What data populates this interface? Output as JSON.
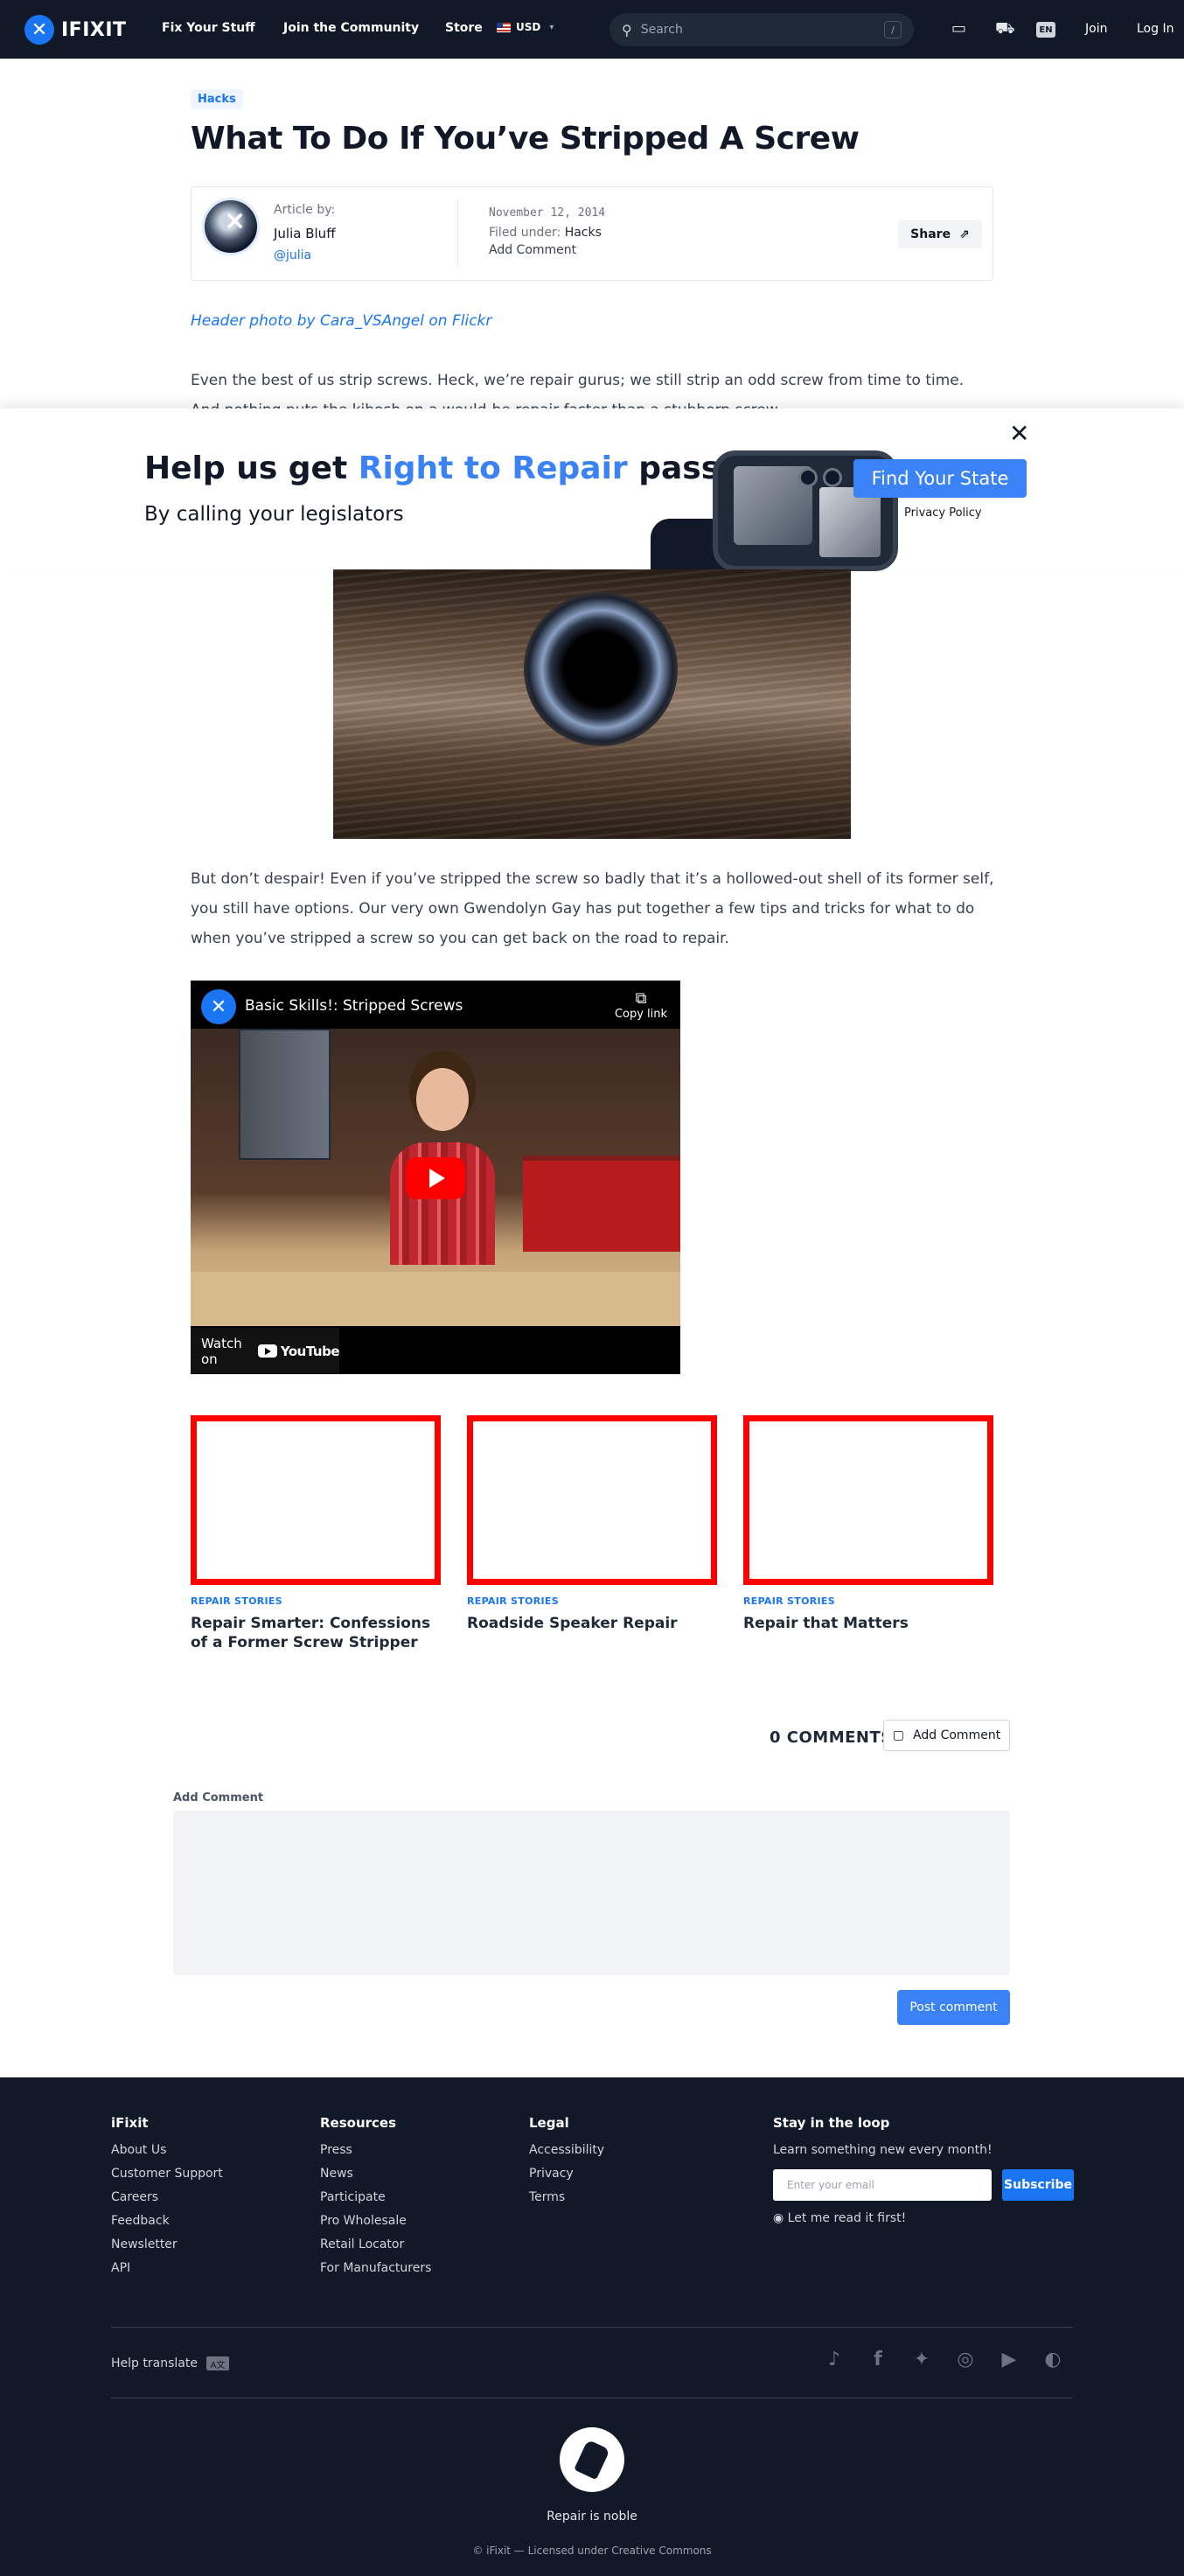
{
  "nav": {
    "brand": "IFIXIT",
    "links": [
      "Fix Your Stuff",
      "Join the Community",
      "Store"
    ],
    "currency": "USD",
    "search_placeholder": "Search",
    "search_shortcut": "/",
    "language": "EN",
    "join": "Join",
    "login": "Log In"
  },
  "article": {
    "tag": "Hacks",
    "title": "What To Do If You’ve Stripped A Screw",
    "byline_label": "Article by:",
    "author": "Julia Bluff",
    "handle": "@julia",
    "date": "November 12, 2014",
    "filed_label": "Filed under:",
    "filed_value": "Hacks",
    "add_comment": "Add Comment",
    "share": "Share",
    "photo_credit": "Header photo by Cara_VSAngel on Flickr",
    "para1": "Even the best of us strip screws. Heck, we’re repair gurus; we still strip an odd screw from time to time. And nothing puts the kibosh on a would-be repair faster than a stubborn screw.",
    "para2": "But don’t despair! Even if you’ve stripped the screw so badly that it’s a hollowed-out shell of its former self, you still have options. Our very own Gwendolyn Gay has put together a few tips and tricks for what to do when you’ve stripped a screw so you can get back on the road to repair."
  },
  "banner": {
    "close": "✕",
    "heading_pre": "Help us get ",
    "heading_highlight": "Right to Repair",
    "heading_post": " passed",
    "subheading": "By calling your legislators",
    "cta": "Find Your State",
    "privacy": "Privacy Policy"
  },
  "video": {
    "channel_glyph": "✕",
    "title": "Basic Skills!: Stripped Screws",
    "copy_link": "Copy link",
    "watch_on": "Watch on",
    "youtube": "YouTube"
  },
  "related": [
    {
      "kicker": "REPAIR STORIES",
      "title": "Repair Smarter: Confessions of a Former Screw Stripper"
    },
    {
      "kicker": "REPAIR STORIES",
      "title": "Roadside Speaker Repair"
    },
    {
      "kicker": "REPAIR STORIES",
      "title": "Repair that Matters"
    }
  ],
  "comments": {
    "count_label": "0 COMMENTS",
    "add_button": "Add Comment",
    "add_label": "Add Comment",
    "post_button": "Post comment"
  },
  "footer": {
    "col1": {
      "title": "iFixit",
      "links": [
        "About Us",
        "Customer Support",
        "Careers",
        "Feedback",
        "Newsletter",
        "API"
      ]
    },
    "col2": {
      "title": "Resources",
      "links": [
        "Press",
        "News",
        "Participate",
        "Pro Wholesale",
        "Retail Locator",
        "For Manufacturers"
      ]
    },
    "col3": {
      "title": "Legal",
      "links": [
        "Accessibility",
        "Privacy",
        "Terms"
      ]
    },
    "newsletter": {
      "title": "Stay in the loop",
      "text": "Learn something new every month!",
      "placeholder": "Enter your email",
      "button": "Subscribe",
      "read_it": "Let me read it first!"
    },
    "help_translate": "Help translate",
    "tagline": "Repair is noble",
    "license": "© iFixit — Licensed under Creative Commons"
  },
  "icons": {
    "brand_blue": "#1975f2",
    "cta_blue": "#3b82f6",
    "related_border": "#ff0000"
  }
}
